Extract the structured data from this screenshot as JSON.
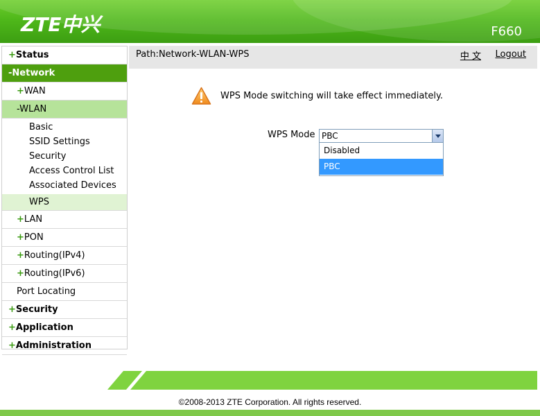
{
  "header": {
    "logo": "ZTE中兴",
    "model": "F660"
  },
  "sidebar": {
    "items": [
      {
        "sign": "+",
        "label": "Status"
      },
      {
        "sign": "-",
        "label": "Network"
      },
      {
        "sign": "+",
        "label": "WAN"
      },
      {
        "sign": "-",
        "label": "WLAN"
      },
      {
        "label": "Basic"
      },
      {
        "label": "SSID Settings"
      },
      {
        "label": "Security"
      },
      {
        "label": "Access Control List"
      },
      {
        "label": "Associated Devices"
      },
      {
        "label": "WPS"
      },
      {
        "sign": "+",
        "label": "LAN"
      },
      {
        "sign": "+",
        "label": "PON"
      },
      {
        "sign": "+",
        "label": "Routing(IPv4)"
      },
      {
        "sign": "+",
        "label": "Routing(IPv6)"
      },
      {
        "label": "Port Locating"
      },
      {
        "sign": "+",
        "label": "Security"
      },
      {
        "sign": "+",
        "label": "Application"
      },
      {
        "sign": "+",
        "label": "Administration"
      }
    ]
  },
  "pathbar": {
    "path": "Path:Network-WLAN-WPS",
    "language": "中 文",
    "logout": "Logout"
  },
  "notice": {
    "icon": "warning-icon",
    "message": "WPS Mode switching will take effect immediately."
  },
  "wps": {
    "label": "WPS Mode",
    "selected": "PBC",
    "options": [
      "Disabled",
      "PBC"
    ]
  },
  "footer": {
    "copyright": "©2008-2013 ZTE Corporation. All rights reserved."
  },
  "colors": {
    "brand_green": "#4e9f0e",
    "highlight_green": "#b6e39a",
    "selection_blue": "#3399ff"
  }
}
